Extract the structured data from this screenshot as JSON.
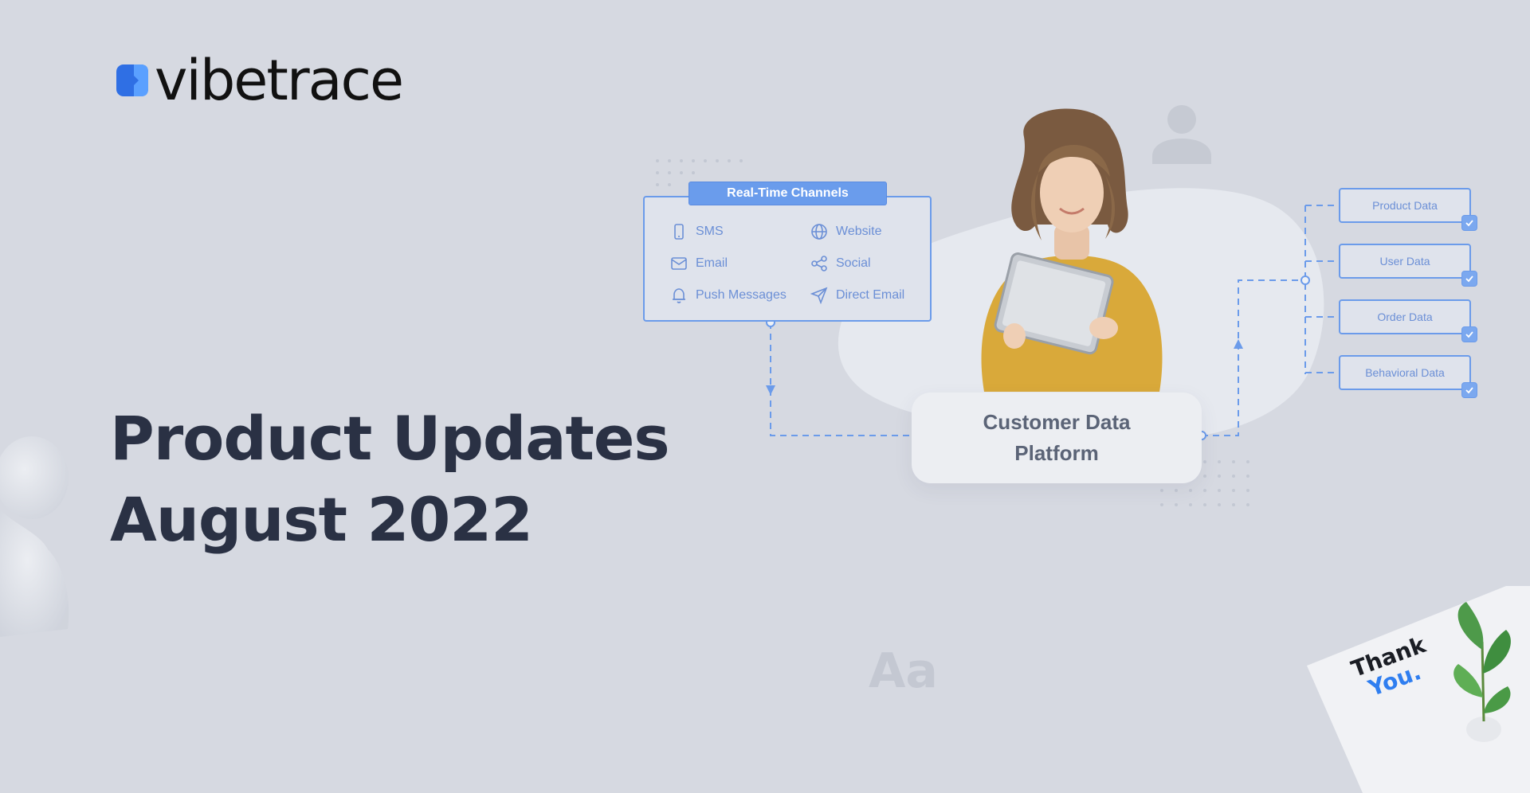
{
  "brand": {
    "name": "vibetrace"
  },
  "headline": {
    "line1": "Product Updates",
    "line2": "August 2022"
  },
  "channels": {
    "title": "Real-Time Channels",
    "items": [
      {
        "label": "SMS",
        "icon": "phone-icon"
      },
      {
        "label": "Website",
        "icon": "globe-icon"
      },
      {
        "label": "Email",
        "icon": "mail-icon"
      },
      {
        "label": "Social",
        "icon": "share-icon"
      },
      {
        "label": "Push Messages",
        "icon": "bell-icon"
      },
      {
        "label": "Direct Email",
        "icon": "send-icon"
      }
    ]
  },
  "cdp": {
    "line1": "Customer Data",
    "line2": "Platform"
  },
  "data_sources": [
    {
      "label": "Product Data"
    },
    {
      "label": "User Data"
    },
    {
      "label": "Order Data"
    },
    {
      "label": "Behavioral Data"
    }
  ],
  "decor": {
    "aa": "Aa",
    "thank": "Thank",
    "you": "You."
  },
  "colors": {
    "background": "#d6d9e1",
    "accent": "#6a9cec",
    "headline": "#2a3144",
    "brand_mark": "#2f6fe4"
  }
}
